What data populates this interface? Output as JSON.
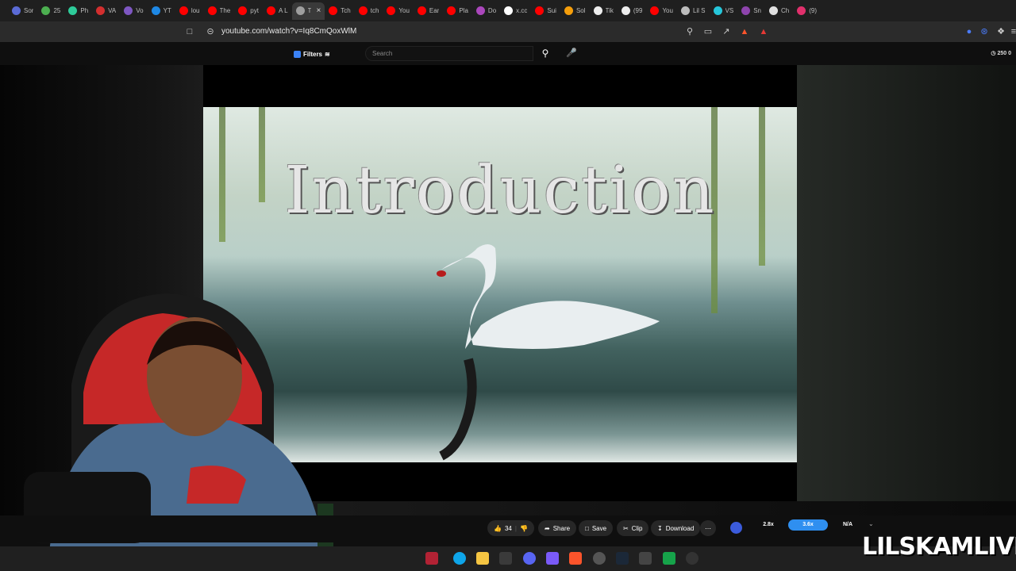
{
  "browser": {
    "tabs": [
      {
        "label": "Sor",
        "color": "#5b6bd6"
      },
      {
        "label": "25",
        "color": "#4caf50"
      },
      {
        "label": "Ph",
        "color": "#2ecc9a"
      },
      {
        "label": "VA",
        "color": "#d32f2f"
      },
      {
        "label": "Vo",
        "color": "#7e57c2"
      },
      {
        "label": "YT",
        "color": "#1e88e5"
      },
      {
        "label": "lou",
        "color": "#ff0000"
      },
      {
        "label": "The",
        "color": "#ff0000"
      },
      {
        "label": "pyt",
        "color": "#ff0000"
      },
      {
        "label": "A L",
        "color": "#ff0000"
      },
      {
        "label": "T",
        "color": "#9e9e9e",
        "active": true
      },
      {
        "label": "Tch",
        "color": "#ff0000"
      },
      {
        "label": "tch",
        "color": "#ff0000"
      },
      {
        "label": "You",
        "color": "#ff0000"
      },
      {
        "label": "Ear",
        "color": "#ff0000"
      },
      {
        "label": "Pla",
        "color": "#ff0000"
      },
      {
        "label": "Do",
        "color": "#ab47bc"
      },
      {
        "label": "x.cc",
        "color": "#ffffff"
      },
      {
        "label": "Sui",
        "color": "#ff0000"
      },
      {
        "label": "Sol",
        "color": "#f59e0b"
      },
      {
        "label": "Tik",
        "color": "#eeeeee"
      },
      {
        "label": "(99",
        "color": "#eeeeee"
      },
      {
        "label": "You",
        "color": "#ff0000"
      },
      {
        "label": "Lil S",
        "color": "#bdbdbd"
      },
      {
        "label": "VS",
        "color": "#26c6da"
      },
      {
        "label": "Sn",
        "color": "#8e44ad"
      },
      {
        "label": "Ch",
        "color": "#e0e0e0"
      },
      {
        "label": "(9)",
        "color": "#e1306c"
      }
    ],
    "url": "youtube.com/watch?v=Iq8CmQoxWlM"
  },
  "youtube": {
    "filters_label": "Filters",
    "search_placeholder": "Search",
    "counter": "250",
    "counter_b": "0",
    "video_title_text": "Introduction",
    "likes": "34",
    "share_label": "Share",
    "save_label": "Save",
    "clip_label": "Clip",
    "download_label": "Download",
    "speed_options": [
      "2.8x",
      "3.6x",
      "N/A"
    ],
    "speed_selected": "3.6x"
  },
  "watermark": "LILSKAMLIVE"
}
